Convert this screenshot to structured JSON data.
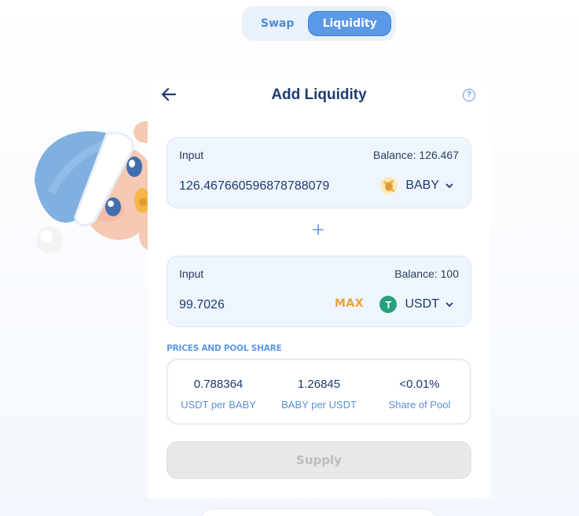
{
  "nav": {
    "tabs": [
      {
        "label": "Swap",
        "active": false
      },
      {
        "label": "Liquidity",
        "active": true
      }
    ]
  },
  "card": {
    "title": "Add Liquidity",
    "help_symbol": "?"
  },
  "input_a": {
    "label": "Input",
    "balance": "Balance: 126.467",
    "value": "126.467660596878788079",
    "token": "BABY",
    "token_icon": "baby-token-icon"
  },
  "input_b": {
    "label": "Input",
    "balance": "Balance: 100",
    "value": "99.7026",
    "max_label": "MAX",
    "token": "USDT",
    "token_icon": "usdt-token-icon",
    "token_symbol": "T"
  },
  "pool": {
    "title": "PRICES AND POOL SHARE",
    "items": [
      {
        "value": "0.788364",
        "label": "USDT per BABY"
      },
      {
        "value": "1.26845",
        "label": "BABY per USDT"
      },
      {
        "value": "<0.01%",
        "label": "Share of Pool"
      }
    ]
  },
  "supply_label": "Supply",
  "colors": {
    "accent": "#5b98e6",
    "max": "#e8a33b",
    "usdt": "#26a17b",
    "title": "#1e3a6e",
    "disabled": "#e8e8e8"
  }
}
